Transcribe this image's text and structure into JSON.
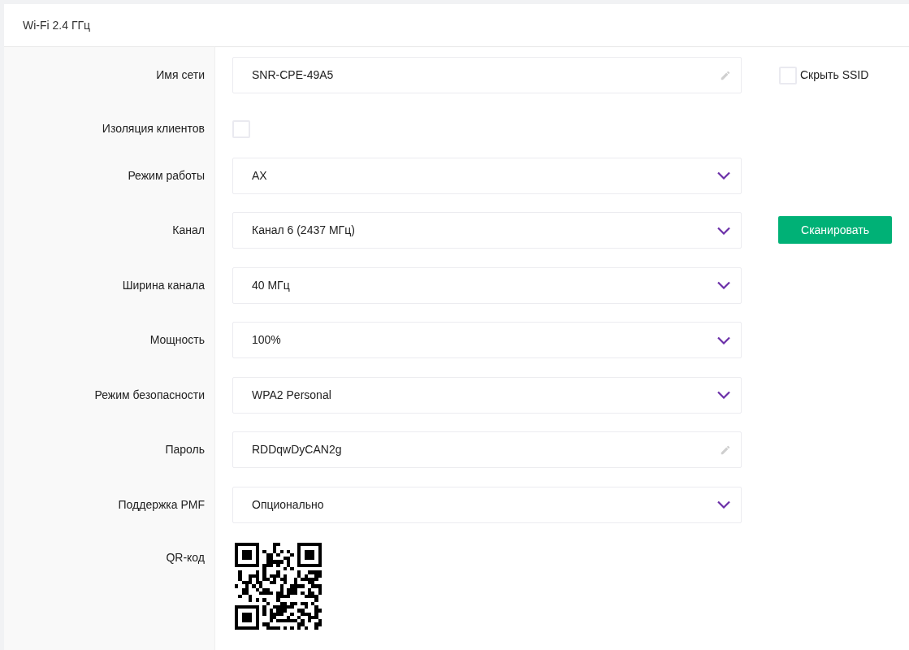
{
  "card": {
    "title": "Wi-Fi 2.4 ГГц"
  },
  "rows": [
    {
      "kind": "text",
      "label": "Имя сети",
      "value": "SNR-CPE-49A5",
      "extra": {
        "kind": "checkbox",
        "label": "Скрыть SSID",
        "checked": false
      }
    },
    {
      "kind": "checkbox",
      "label": "Изоляция клиентов",
      "checked": false
    },
    {
      "kind": "select",
      "label": "Режим работы",
      "value": "AX"
    },
    {
      "kind": "select",
      "label": "Канал",
      "value": "Канал 6 (2437 МГц)",
      "extra": {
        "kind": "button",
        "label": "Сканировать"
      }
    },
    {
      "kind": "select",
      "label": "Ширина канала",
      "value": "40 МГц"
    },
    {
      "kind": "select",
      "label": "Мощность",
      "value": "100%"
    },
    {
      "kind": "select",
      "label": "Режим безопасности",
      "value": "WPA2 Personal"
    },
    {
      "kind": "text",
      "label": "Пароль",
      "value": "RDDqwDyCAN2g"
    },
    {
      "kind": "select",
      "label": "Поддержка PMF",
      "value": "Опционально"
    },
    {
      "kind": "qr",
      "label": "QR-код"
    }
  ]
}
